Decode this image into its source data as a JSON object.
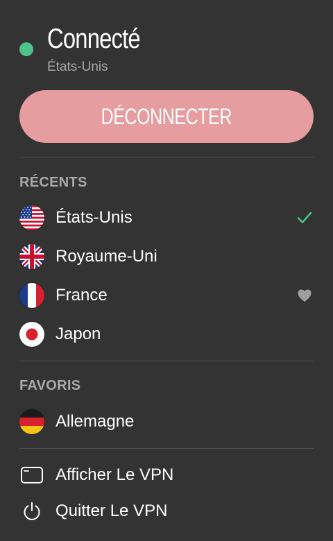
{
  "status": {
    "title": "Connecté",
    "location": "États-Unis",
    "dot_color": "#4cc38a"
  },
  "disconnect_button": {
    "label": "DÉCONNECTER",
    "color": "#e59da0"
  },
  "recents": {
    "title": "RÉCENTS",
    "items": [
      {
        "label": "États-Unis",
        "flag": "us-flag",
        "trailing": "check-icon"
      },
      {
        "label": "Royaume-Uni",
        "flag": "uk-flag",
        "trailing": ""
      },
      {
        "label": "France",
        "flag": "france-flag",
        "trailing": "heart-icon"
      },
      {
        "label": "Japon",
        "flag": "japan-flag",
        "trailing": ""
      }
    ]
  },
  "favorites": {
    "title": "FAVORIS",
    "items": [
      {
        "label": "Allemagne",
        "flag": "germany-flag",
        "trailing": ""
      }
    ]
  },
  "menu": {
    "show_vpn": "Afficher Le VPN",
    "quit_vpn": "Quitter Le VPN"
  },
  "colors": {
    "background": "#333333",
    "check": "#4cc38a",
    "muted": "#a9a9a9"
  }
}
